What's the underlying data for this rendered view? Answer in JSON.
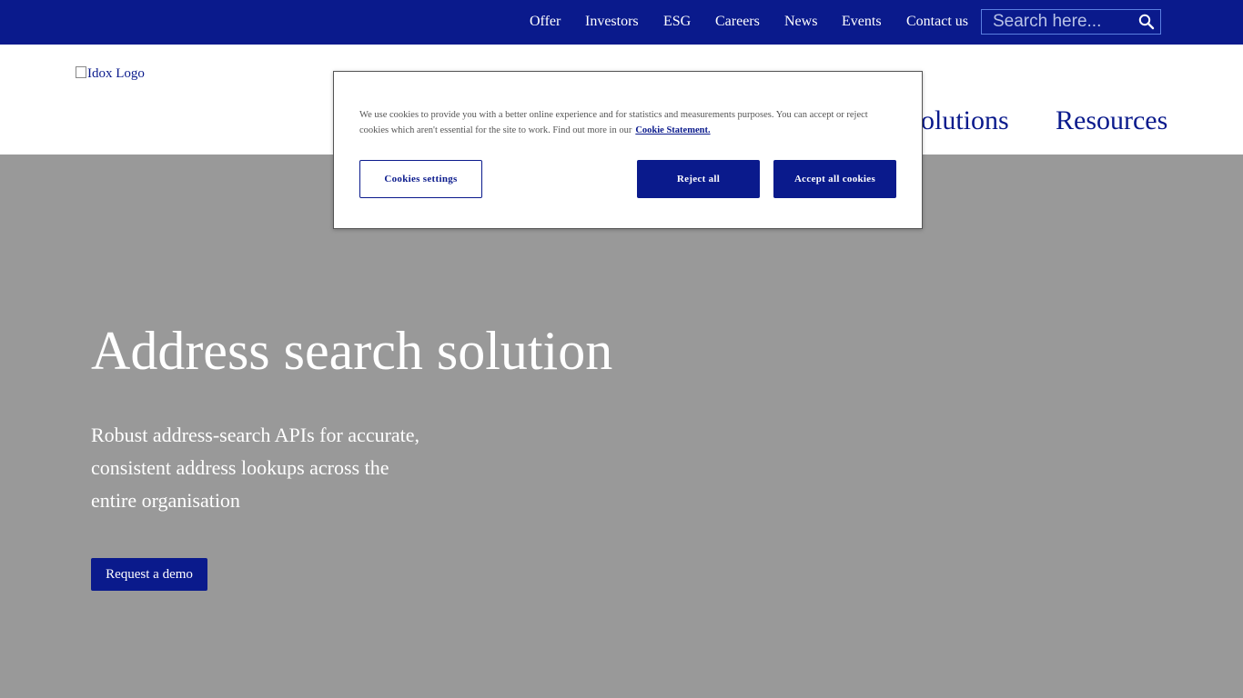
{
  "topbar": {
    "links": [
      "Offer",
      "Investors",
      "ESG",
      "Careers",
      "News",
      "Events",
      "Contact us"
    ],
    "search_placeholder": "Search here...",
    "background_color": "#0a1a8c"
  },
  "header": {
    "logo_alt": "Idox Logo",
    "nav_items": [
      "olutions",
      "Resources"
    ]
  },
  "hero": {
    "title": "Address search solution",
    "subtitle": "Robust address-search APIs for accurate, consistent address lookups across the entire organisation",
    "cta_label": "Request a demo",
    "background_color": "#999999"
  },
  "cookie_banner": {
    "text": "We use cookies to provide you with a better online experience and for statistics and measurements purposes. You can accept or reject cookies which aren't essential for the site to work. Find out more in our",
    "link_label": "Cookie Statement.",
    "settings_label": "Cookies settings",
    "reject_label": "Reject all",
    "accept_label": "Accept all cookies"
  },
  "icons": {
    "search": "search-icon"
  }
}
